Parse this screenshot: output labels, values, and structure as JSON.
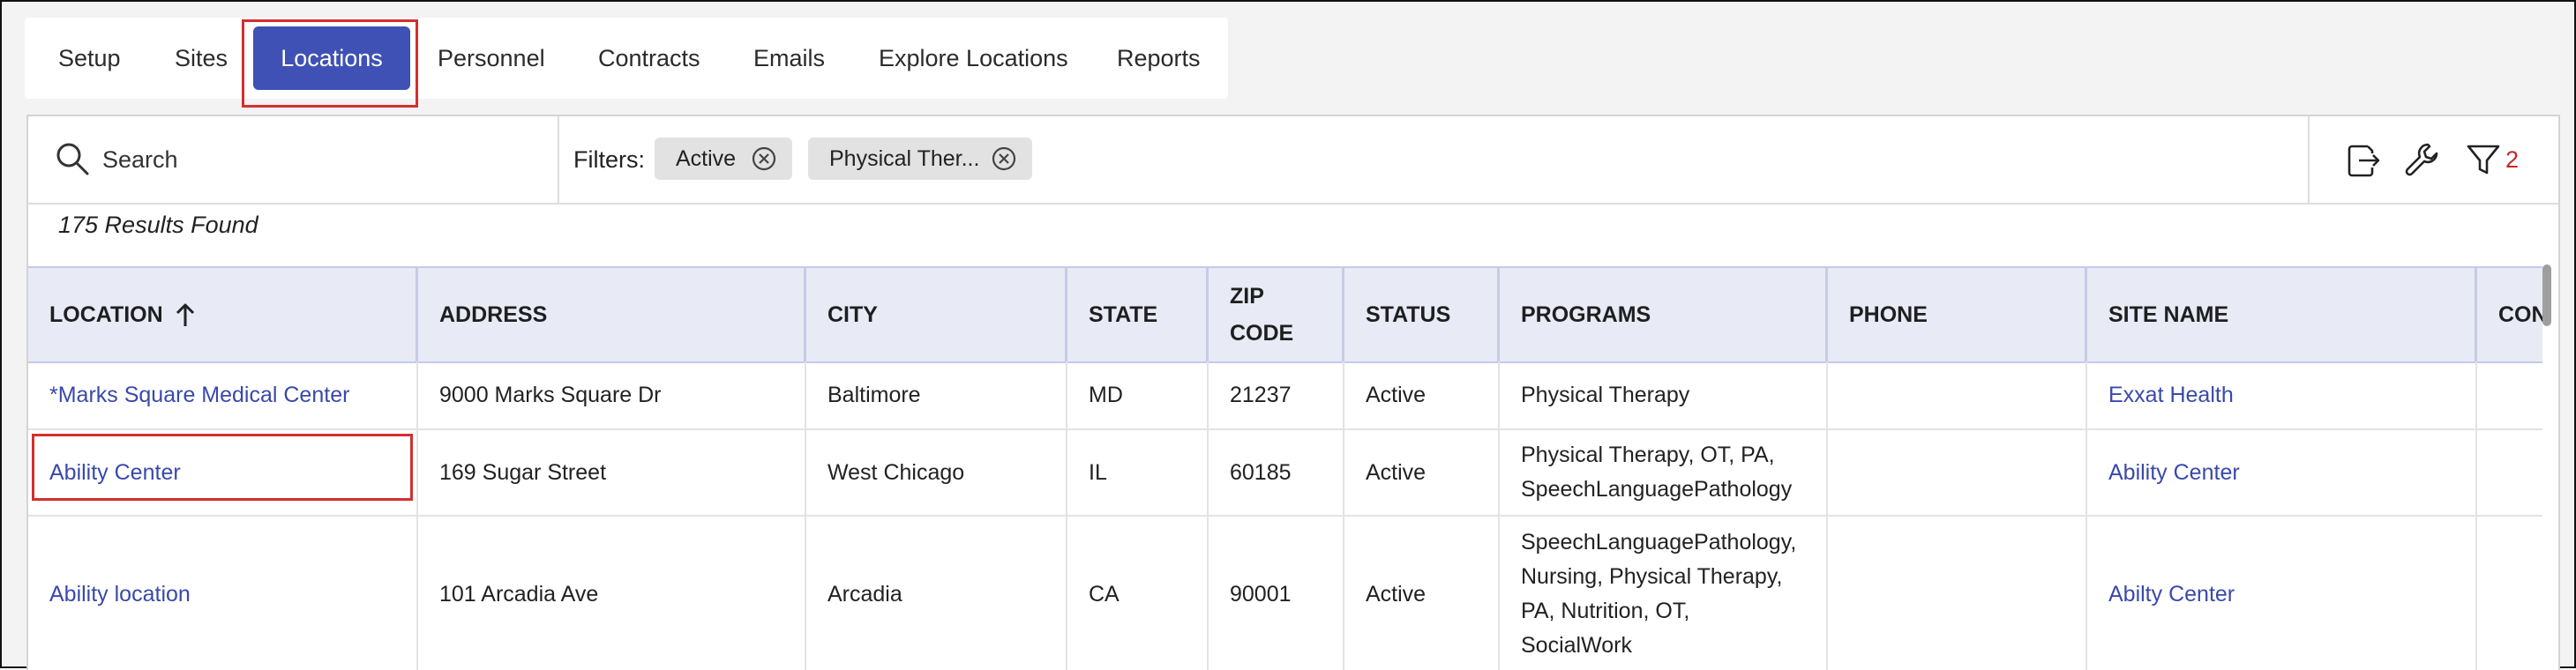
{
  "tabs": [
    {
      "label": "Setup"
    },
    {
      "label": "Sites"
    },
    {
      "label": "Locations",
      "active": true
    },
    {
      "label": "Personnel"
    },
    {
      "label": "Contracts"
    },
    {
      "label": "Emails"
    },
    {
      "label": "Explore Locations"
    },
    {
      "label": "Reports"
    }
  ],
  "toolbar": {
    "search_placeholder": "Search",
    "filters_label": "Filters:",
    "chips": [
      {
        "label": "Active"
      },
      {
        "label": "Physical Ther..."
      }
    ],
    "filter_count": "2",
    "icons": [
      "export-icon",
      "wrench-icon",
      "filter-icon"
    ]
  },
  "results_text": "175 Results Found",
  "table": {
    "headers": {
      "location": "LOCATION",
      "address": "ADDRESS",
      "city": "CITY",
      "state": "STATE",
      "zip_1": "ZIP",
      "zip_2": "CODE",
      "status": "STATUS",
      "programs": "PROGRAMS",
      "phone": "PHONE",
      "site_name": "SITE NAME",
      "contact": "CONT"
    },
    "sort": {
      "column": "LOCATION",
      "direction": "ascending"
    },
    "rows": [
      {
        "location": "*Marks Square Medical Center",
        "address": "9000 Marks Square Dr",
        "city": "Baltimore",
        "state": "MD",
        "zip": "21237",
        "status": "Active",
        "programs": [
          "Physical Therapy"
        ],
        "phone": "",
        "site_name": "Exxat Health"
      },
      {
        "location": "Ability Center",
        "address": "169 Sugar Street",
        "city": "West Chicago",
        "state": "IL",
        "zip": "60185",
        "status": "Active",
        "programs": [
          "Physical Therapy, OT, PA,",
          "SpeechLanguagePathology"
        ],
        "phone": "",
        "site_name": "Ability Center"
      },
      {
        "location": "Ability location",
        "address": "101 Arcadia Ave",
        "city": "Arcadia",
        "state": "CA",
        "zip": "90001",
        "status": "Active",
        "programs": [
          "SpeechLanguagePathology,",
          "Nursing, Physical Therapy,",
          "PA, Nutrition, OT,",
          "SocialWork"
        ],
        "phone": "",
        "site_name": "Abilty Center"
      }
    ]
  },
  "colors": {
    "accent": "#3f51b5",
    "link": "#3949ab",
    "header_bg": "#e8eaf6",
    "highlight": "#d32f2f",
    "filter_count": "#c62828"
  }
}
